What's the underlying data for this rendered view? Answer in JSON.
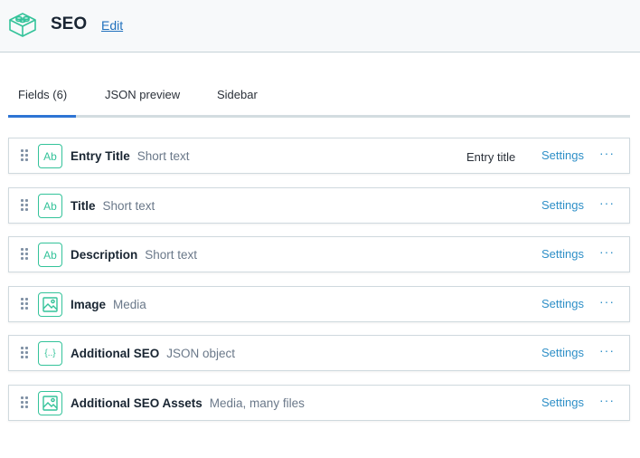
{
  "header": {
    "title": "SEO",
    "edit_label": "Edit",
    "logo_icon": "content-type-block-icon",
    "accent_color": "#34c39a"
  },
  "tabs": [
    {
      "label": "Fields (6)",
      "active": true
    },
    {
      "label": "JSON preview",
      "active": false
    },
    {
      "label": "Sidebar",
      "active": false
    }
  ],
  "fields": [
    {
      "name": "Entry Title",
      "type": "Short text",
      "icon": "text-field-icon",
      "icon_text": "Ab",
      "entry_title_label": "Entry title",
      "settings_label": "Settings",
      "more_label": "···"
    },
    {
      "name": "Title",
      "type": "Short text",
      "icon": "text-field-icon",
      "icon_text": "Ab",
      "settings_label": "Settings",
      "more_label": "···"
    },
    {
      "name": "Description",
      "type": "Short text",
      "icon": "text-field-icon",
      "icon_text": "Ab",
      "settings_label": "Settings",
      "more_label": "···"
    },
    {
      "name": "Image",
      "type": "Media",
      "icon": "media-field-icon",
      "settings_label": "Settings",
      "more_label": "···"
    },
    {
      "name": "Additional SEO",
      "type": "JSON object",
      "icon": "json-field-icon",
      "icon_text": "{..}",
      "settings_label": "Settings",
      "more_label": "···"
    },
    {
      "name": "Additional SEO Assets",
      "type": "Media, many files",
      "icon": "media-field-icon",
      "settings_label": "Settings",
      "more_label": "···"
    }
  ]
}
